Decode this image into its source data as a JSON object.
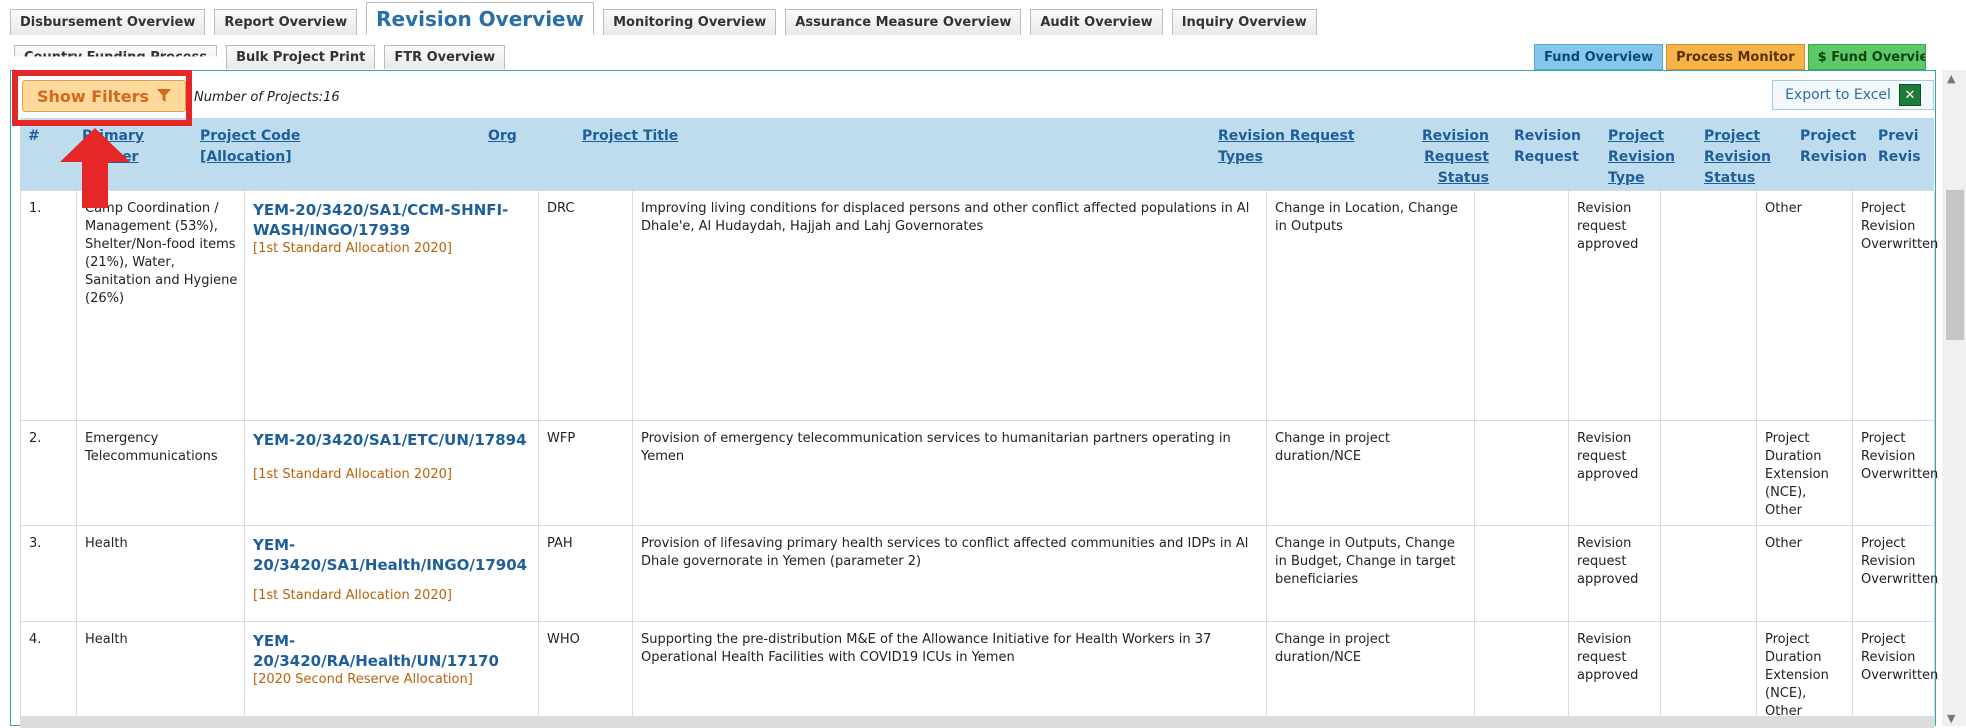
{
  "tabs_row1": [
    {
      "label": "Disbursement Overview"
    },
    {
      "label": "Report Overview"
    },
    {
      "label": "Revision Overview",
      "active": true
    },
    {
      "label": "Monitoring Overview"
    },
    {
      "label": "Assurance Measure Overview"
    },
    {
      "label": "Audit Overview"
    },
    {
      "label": "Inquiry Overview"
    }
  ],
  "tabs_row2": [
    {
      "label": "Country Funding Process"
    },
    {
      "label": "Bulk Project Print"
    },
    {
      "label": "FTR Overview"
    }
  ],
  "right_buttons": {
    "fund": "Fund Overview",
    "process": "Process Monitor",
    "sfund": "$ Fund Overview"
  },
  "filters": {
    "label": "Show Filters"
  },
  "count": "Number of Projects:16",
  "export": {
    "label": "Export to Excel",
    "icon": "excel-icon"
  },
  "headers": {
    "num": "#",
    "cluster_1": "Primary",
    "cluster_2": "Cluster",
    "code_1": "Project Code",
    "code_2": "[Allocation]",
    "org": "Org",
    "title": "Project Title",
    "types_1": "Revision Request",
    "types_2": "Types",
    "rstatus_1": "Revision",
    "rstatus_2": "Request",
    "rstatus_3": "Status",
    "rreq_1": "Revision",
    "rreq_2": "Request",
    "prtype_1": "Project",
    "prtype_2": "Revision",
    "prtype_3": "Type",
    "prstatus_1": "Project",
    "prstatus_2": "Revision",
    "prstatus_3": "Status",
    "prev_1": "Project",
    "prev_2": "Revision",
    "prev2_1": "Previ",
    "prev2_2": "Revis"
  },
  "rows": [
    {
      "num": "1.",
      "cluster": "Camp Coordination / Management (53%), Shelter/Non-food items (21%), Water, Sanitation and Hygiene (26%)",
      "code": "YEM-20/3420/SA1/CCM-SHNFI-WASH/INGO/17939",
      "alloc": "[1st Standard Allocation 2020]",
      "org": "DRC",
      "title": "Improving living conditions for displaced persons and other conflict affected populations in Al Dhale'e, Al Hudaydah, Hajjah and Lahj Governorates",
      "types": "Change in Location, Change in Outputs",
      "rstatus": "Revision request approved",
      "prtype": "",
      "prstatus": "Other",
      "prev": "Project Revision Overwritten"
    },
    {
      "num": "2.",
      "cluster": "Emergency Telecommunications",
      "code": "YEM-20/3420/SA1/ETC/UN/17894",
      "alloc": "[1st Standard Allocation 2020]",
      "org": "WFP",
      "title": "Provision of emergency telecommunication services to humanitarian partners operating in Yemen",
      "types": "Change in project duration/NCE",
      "rstatus": "Revision request approved",
      "prtype": "",
      "prstatus": "Project Duration Extension (NCE), Other",
      "prev": "Project Revision Overwritten"
    },
    {
      "num": "3.",
      "cluster": "Health",
      "code": "YEM-20/3420/SA1/Health/INGO/17904",
      "alloc": "[1st Standard Allocation 2020]",
      "org": "PAH",
      "title": "Provision of lifesaving primary health services to conflict affected communities and IDPs in Al Dhale governorate in Yemen (parameter 2)",
      "types": "Change in Outputs, Change in Budget, Change in target beneficiaries",
      "rstatus": "Revision request approved",
      "prtype": "",
      "prstatus": "Other",
      "prev": "Project Revision Overwritten"
    },
    {
      "num": "4.",
      "cluster": "Health",
      "code": "YEM-20/3420/RA/Health/UN/17170",
      "alloc": "[2020 Second Reserve Allocation]",
      "org": "WHO",
      "title": "Supporting the pre-distribution M&E of the Allowance Initiative for Health Workers in 37 Operational Health Facilities with COVID19 ICUs in Yemen",
      "types": "Change in project duration/NCE",
      "rstatus": "Revision request approved",
      "prtype": "",
      "prstatus": "Project Duration Extension (NCE), Other",
      "prev": "Project Revision Overwritten"
    }
  ]
}
